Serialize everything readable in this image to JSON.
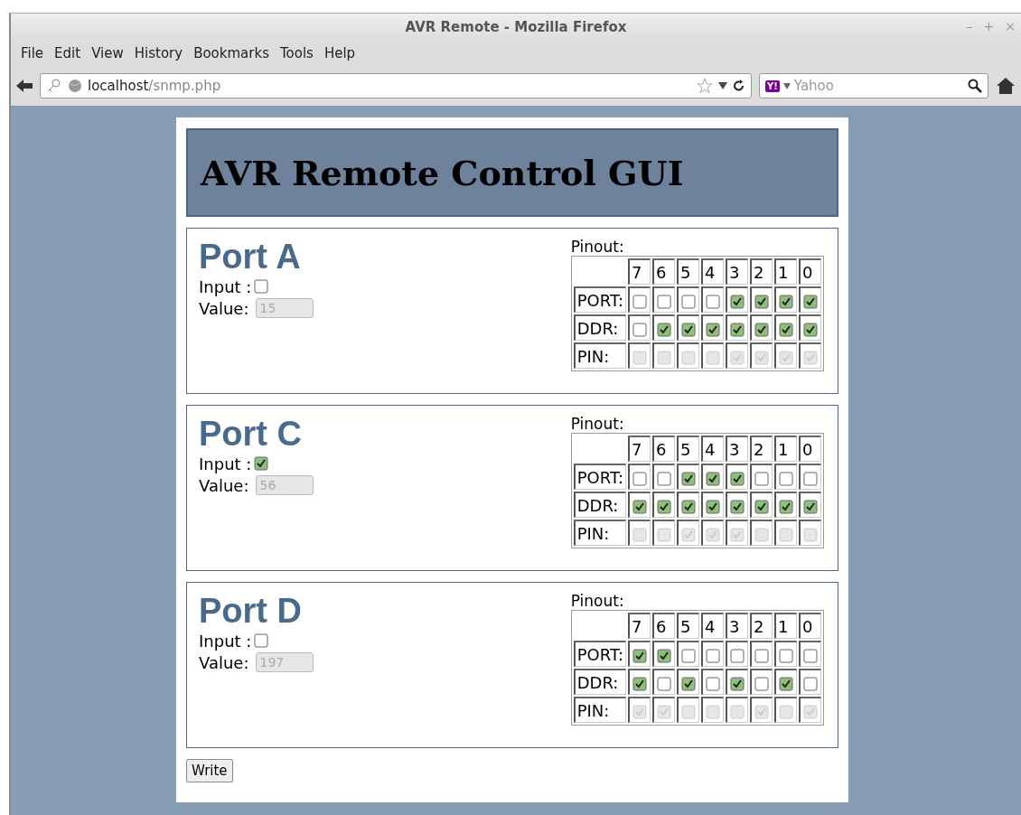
{
  "window": {
    "title": "AVR Remote - Mozilla Firefox",
    "controls": [
      "–",
      "+",
      "×"
    ]
  },
  "menu": [
    "File",
    "Edit",
    "View",
    "History",
    "Bookmarks",
    "Tools",
    "Help"
  ],
  "navbar": {
    "url_host": "localhost",
    "url_path": "/snmp.php",
    "search_engine": "Y!",
    "search_placeholder": "Yahoo"
  },
  "page": {
    "heading": "AVR Remote Control GUI",
    "ports": [
      {
        "title": "Port A",
        "input_label": "Input :",
        "input_checked": false,
        "value_label": "Value:",
        "value": "15",
        "pinout_label": "Pinout:",
        "bit_headers": [
          "7",
          "6",
          "5",
          "4",
          "3",
          "2",
          "1",
          "0"
        ],
        "rows": [
          {
            "label": "PORT:",
            "disabled": false,
            "bits": [
              {
                "checked": false
              },
              {
                "checked": false
              },
              {
                "checked": false
              },
              {
                "checked": false
              },
              {
                "checked": true
              },
              {
                "checked": true
              },
              {
                "checked": true
              },
              {
                "checked": true
              }
            ]
          },
          {
            "label": "DDR:",
            "disabled": false,
            "bits": [
              {
                "checked": false
              },
              {
                "checked": true
              },
              {
                "checked": true
              },
              {
                "checked": true
              },
              {
                "checked": true
              },
              {
                "checked": true
              },
              {
                "checked": true
              },
              {
                "checked": true
              }
            ]
          },
          {
            "label": "PIN:",
            "disabled": true,
            "bits": [
              {
                "checked": false
              },
              {
                "checked": false
              },
              {
                "checked": false
              },
              {
                "checked": false
              },
              {
                "checked": true
              },
              {
                "checked": true
              },
              {
                "checked": true
              },
              {
                "checked": true
              }
            ]
          }
        ]
      },
      {
        "title": "Port C",
        "input_label": "Input :",
        "input_checked": true,
        "value_label": "Value:",
        "value": "56",
        "pinout_label": "Pinout:",
        "bit_headers": [
          "7",
          "6",
          "5",
          "4",
          "3",
          "2",
          "1",
          "0"
        ],
        "rows": [
          {
            "label": "PORT:",
            "disabled": false,
            "bits": [
              {
                "checked": false
              },
              {
                "checked": false
              },
              {
                "checked": true
              },
              {
                "checked": true
              },
              {
                "checked": true
              },
              {
                "checked": false
              },
              {
                "checked": false
              },
              {
                "checked": false
              }
            ]
          },
          {
            "label": "DDR:",
            "disabled": false,
            "bits": [
              {
                "checked": true
              },
              {
                "checked": true
              },
              {
                "checked": true
              },
              {
                "checked": true
              },
              {
                "checked": true
              },
              {
                "checked": true
              },
              {
                "checked": true
              },
              {
                "checked": true
              }
            ]
          },
          {
            "label": "PIN:",
            "disabled": true,
            "bits": [
              {
                "checked": false
              },
              {
                "checked": false
              },
              {
                "checked": true
              },
              {
                "checked": true
              },
              {
                "checked": true
              },
              {
                "checked": false
              },
              {
                "checked": false
              },
              {
                "checked": false
              }
            ]
          }
        ]
      },
      {
        "title": "Port D",
        "input_label": "Input :",
        "input_checked": false,
        "value_label": "Value:",
        "value": "197",
        "pinout_label": "Pinout:",
        "bit_headers": [
          "7",
          "6",
          "5",
          "4",
          "3",
          "2",
          "1",
          "0"
        ],
        "rows": [
          {
            "label": "PORT:",
            "disabled": false,
            "bits": [
              {
                "checked": true
              },
              {
                "checked": true
              },
              {
                "checked": false
              },
              {
                "checked": false
              },
              {
                "checked": false
              },
              {
                "checked": false
              },
              {
                "checked": false
              },
              {
                "checked": false
              }
            ]
          },
          {
            "label": "DDR:",
            "disabled": false,
            "bits": [
              {
                "checked": true
              },
              {
                "checked": false
              },
              {
                "checked": true
              },
              {
                "checked": false
              },
              {
                "checked": true
              },
              {
                "checked": false
              },
              {
                "checked": true
              },
              {
                "checked": false
              }
            ]
          },
          {
            "label": "PIN:",
            "disabled": true,
            "bits": [
              {
                "checked": true
              },
              {
                "checked": true
              },
              {
                "checked": false
              },
              {
                "checked": false
              },
              {
                "checked": false
              },
              {
                "checked": true
              },
              {
                "checked": false
              },
              {
                "checked": true
              }
            ]
          }
        ]
      }
    ],
    "write_button": "Write"
  }
}
